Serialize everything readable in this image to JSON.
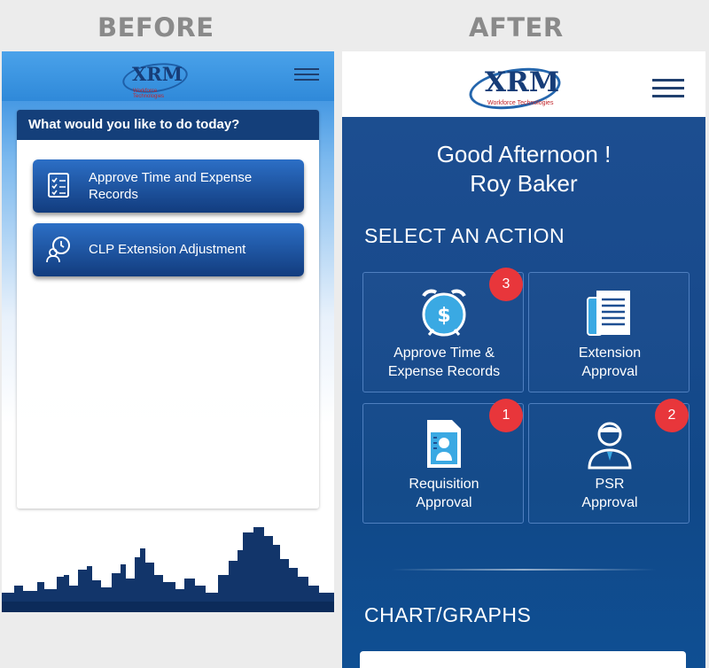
{
  "labels": {
    "before": "BEFORE",
    "after": "AFTER"
  },
  "before": {
    "logo": {
      "text": "XRM",
      "subtitle": "Workforce Technologies"
    },
    "menu_icon": "hamburger-icon",
    "card_title": "What would you like to do today?",
    "buttons": [
      {
        "label": "Approve Time and Expense Records",
        "icon": "clipboard-checklist-icon"
      },
      {
        "label": "CLP Extension Adjustment",
        "icon": "clock-person-icon"
      }
    ]
  },
  "after": {
    "logo": {
      "text": "XRM",
      "subtitle": "Workforce Technologies"
    },
    "menu_icon": "hamburger-icon",
    "greeting": "Good Afternoon !",
    "user_name": "Roy Baker",
    "actions_title": "SELECT AN ACTION",
    "tiles": [
      {
        "line1": "Approve Time &",
        "line2": "Expense Records",
        "badge": "3",
        "icon": "alarm-clock-dollar-icon"
      },
      {
        "line1": "Extension",
        "line2": "Approval",
        "badge": "",
        "icon": "document-icon"
      },
      {
        "line1": "Requisition",
        "line2": "Approval",
        "badge": "1",
        "icon": "id-document-icon"
      },
      {
        "line1": "PSR",
        "line2": "Approval",
        "badge": "2",
        "icon": "person-icon"
      }
    ],
    "charts_title": "CHART/GRAPHS"
  },
  "colors": {
    "accent": "#1e4f92",
    "badge": "#e8363b",
    "header_before": "#2f89d9",
    "button_before": "#123c7e"
  }
}
